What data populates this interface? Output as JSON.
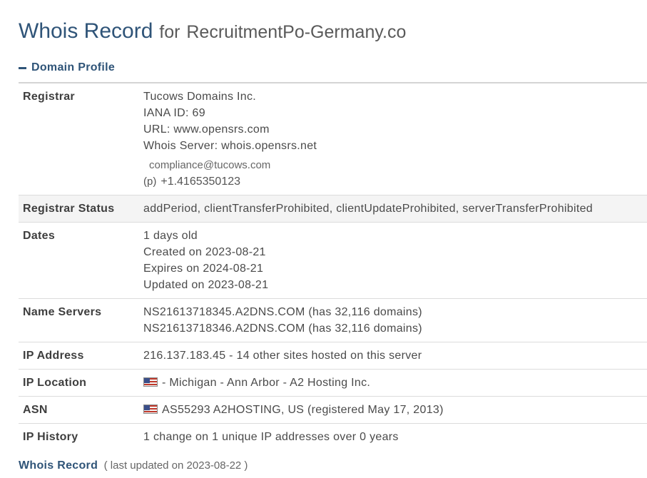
{
  "header": {
    "title": "Whois Record",
    "for_label": "for",
    "domain": "RecruitmentPo-Germany.co"
  },
  "section": {
    "label": "Domain Profile",
    "icon": "minus-icon",
    "color": "#2f5478"
  },
  "registrar": {
    "label": "Registrar",
    "name": "Tucows Domains Inc.",
    "iana": "IANA ID: 69",
    "url": "URL: www.opensrs.com",
    "whois_server": "Whois Server: whois.opensrs.net",
    "email": "compliance@tucows.com",
    "phone_label": "(p)",
    "phone": "+1.4165350123"
  },
  "registrar_status": {
    "label": "Registrar Status",
    "value": "addPeriod, clientTransferProhibited, clientUpdateProhibited, serverTransferProhibited"
  },
  "dates": {
    "label": "Dates",
    "age": "1 days old",
    "created": "Created on 2023-08-21",
    "expires": "Expires on 2024-08-21",
    "updated": "Updated on 2023-08-21"
  },
  "name_servers": {
    "label": "Name Servers",
    "ns1": "NS21613718345.A2DNS.COM (has 32,116 domains)",
    "ns2": "NS21613718346.A2DNS.COM (has 32,116 domains)"
  },
  "ip_address": {
    "label": "IP Address",
    "value": "216.137.183.45 - 14 other sites hosted on this server"
  },
  "ip_location": {
    "label": "IP Location",
    "icon": "us-flag-icon",
    "value": "- Michigan - Ann Arbor - A2 Hosting Inc."
  },
  "asn": {
    "label": "ASN",
    "icon": "us-flag-icon",
    "value": "AS55293 A2HOSTING, US (registered May 17, 2013)"
  },
  "ip_history": {
    "label": "IP History",
    "value": "1 change on 1 unique IP addresses over 0 years"
  },
  "footer": {
    "link": "Whois Record",
    "updated": "( last updated on 2023-08-22 )"
  }
}
